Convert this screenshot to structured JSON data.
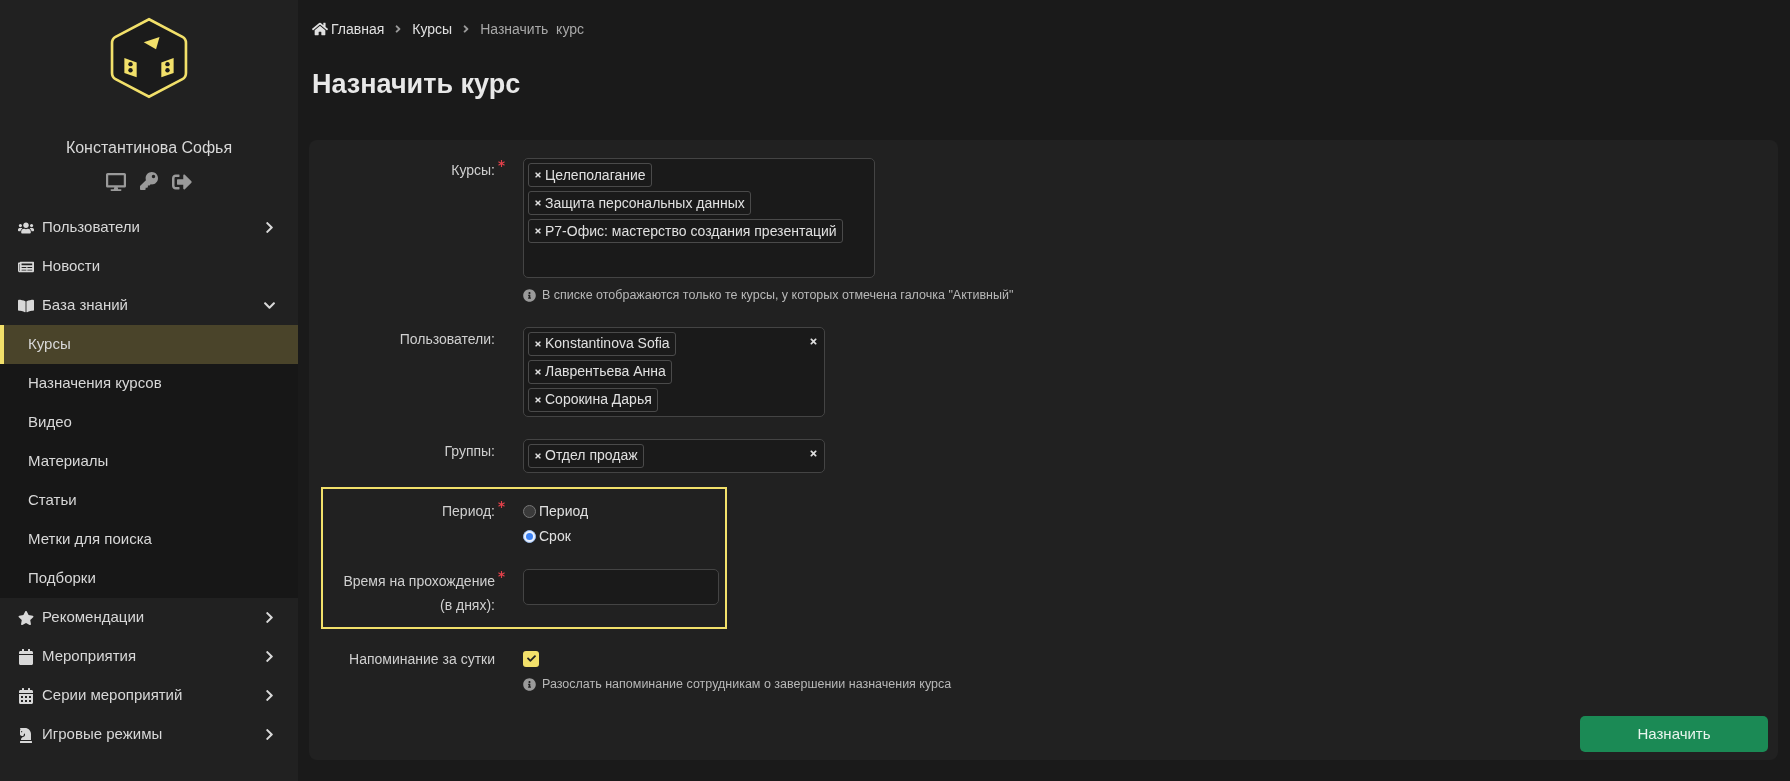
{
  "sidebar": {
    "user_name": "Константинова Софья",
    "items": [
      {
        "label": "Пользователи",
        "has_arrow": true,
        "expanded": false
      },
      {
        "label": "Новости",
        "has_arrow": false
      },
      {
        "label": "База знаний",
        "has_arrow": true,
        "expanded": true,
        "children": [
          {
            "label": "Курсы",
            "selected": true
          },
          {
            "label": "Назначения курсов",
            "selected": false
          },
          {
            "label": "Видео",
            "selected": false
          },
          {
            "label": "Материалы",
            "selected": false
          },
          {
            "label": "Статьи",
            "selected": false
          },
          {
            "label": "Метки для поиска",
            "selected": false
          },
          {
            "label": "Подборки",
            "selected": false
          }
        ]
      },
      {
        "label": "Рекомендации",
        "has_arrow": true,
        "expanded": false
      },
      {
        "label": "Мероприятия",
        "has_arrow": true,
        "expanded": false
      },
      {
        "label": "Серии мероприятий",
        "has_arrow": true,
        "expanded": false
      },
      {
        "label": "Игровые режимы",
        "has_arrow": true,
        "expanded": false
      }
    ]
  },
  "breadcrumbs": [
    {
      "label": "Главная",
      "current": false
    },
    {
      "label": "Курсы",
      "current": false
    },
    {
      "label": "Назначить  курс",
      "current": true
    }
  ],
  "title": "Назначить курс",
  "form": {
    "groups": [
      {
        "highlighted": false,
        "fields": [
          {
            "kind": "tags",
            "label": "Курсы:",
            "required": true,
            "clearable": false,
            "tags": [
              "Целеполагание",
              "Защита персональных данных",
              "Р7-Офис: мастерство создания презентаций"
            ],
            "hint": "В списке отображаются только те курсы, у которых отмечена галочка \"Активный\""
          },
          {
            "kind": "tags",
            "label": "Пользователи:",
            "required": false,
            "clearable": true,
            "tags": [
              "Konstantinova Sofia",
              "Лаврентьева Анна",
              "Сорокина Дарья"
            ]
          },
          {
            "kind": "tags",
            "label": "Группы:",
            "required": false,
            "clearable": true,
            "tags": [
              "Отдел продаж"
            ]
          }
        ]
      },
      {
        "highlighted": true,
        "fields": [
          {
            "kind": "radio",
            "label": "Период:",
            "required": true,
            "options": [
              {
                "label": "Период",
                "selected": false
              },
              {
                "label": "Срок",
                "selected": true
              }
            ]
          },
          {
            "kind": "text",
            "label": "Время на прохождение (в днях):",
            "required": true
          }
        ]
      },
      {
        "highlighted": false,
        "fields": [
          {
            "kind": "checkbox",
            "label": "Напоминание за сутки",
            "required": false,
            "checked": true,
            "hint": "Разослать напоминание сотрудникам о завершении назначения курса"
          }
        ]
      }
    ],
    "submit": "Назначить"
  }
}
